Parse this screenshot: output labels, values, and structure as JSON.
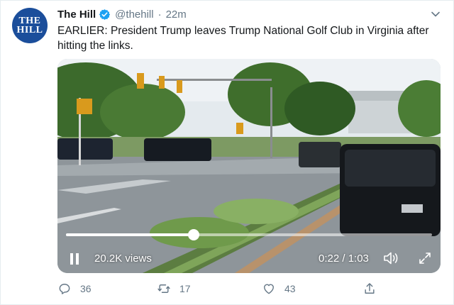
{
  "tweet": {
    "avatar_lines": [
      "THE",
      "HILL"
    ],
    "display_name": "The Hill",
    "handle": "@thehill",
    "separator": "·",
    "timestamp": "22m",
    "text": "EARLIER: President Trump leaves Trump National Golf Club in Virginia after hitting the links."
  },
  "video": {
    "views": "20.2K views",
    "duration": "0:22 / 1:03",
    "progress_fraction": 0.349
  },
  "actions": {
    "reply_count": "36",
    "retweet_count": "17",
    "like_count": "43"
  },
  "colors": {
    "brand_blue": "#1b4e9b",
    "verified_blue": "#1da1f2",
    "muted": "#657786"
  },
  "icons": [
    "verified-badge-icon",
    "chevron-down-icon",
    "pause-icon",
    "volume-icon",
    "fullscreen-icon",
    "reply-icon",
    "retweet-icon",
    "like-icon",
    "share-icon"
  ]
}
